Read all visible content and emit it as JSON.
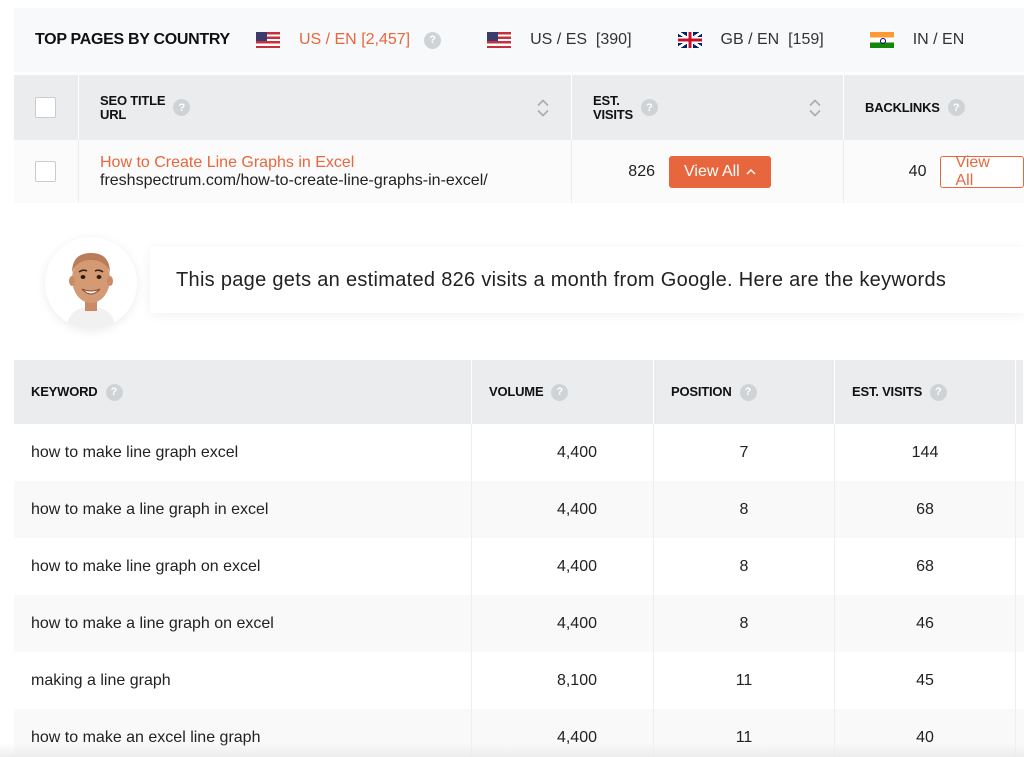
{
  "country_bar": {
    "title": "TOP PAGES BY COUNTRY",
    "tabs": [
      {
        "label": "US / EN",
        "count": "[2,457]",
        "flag": "us-flag-icon",
        "active": true
      },
      {
        "label": "US / ES",
        "count": "[390]",
        "flag": "us-flag-icon",
        "active": false
      },
      {
        "label": "GB / EN",
        "count": "[159]",
        "flag": "gb-flag-icon",
        "active": false
      },
      {
        "label": "IN / EN",
        "count": "",
        "flag": "in-flag-icon",
        "active": false
      }
    ]
  },
  "pages_table": {
    "headers": {
      "title_line1": "SEO TITLE",
      "title_line2": "URL",
      "visits_line1": "EST.",
      "visits_line2": "VISITS",
      "backlinks": "BACKLINKS"
    },
    "row": {
      "title": "How to Create Line Graphs in Excel",
      "url": "freshspectrum.com/how-to-create-line-graphs-in-excel/",
      "est_visits": "826",
      "visits_button": "View All",
      "backlinks": "40",
      "backlinks_button": "View All"
    }
  },
  "message": {
    "text": "This page gets an estimated 826 visits a month from Google. Here are the keywords"
  },
  "keywords_table": {
    "headers": {
      "keyword": "KEYWORD",
      "volume": "VOLUME",
      "position": "POSITION",
      "est_visits": "EST. VISITS"
    },
    "rows": [
      {
        "keyword": "how to make line graph excel",
        "volume": "4,400",
        "position": "7",
        "est_visits": "144"
      },
      {
        "keyword": "how to make a line graph in excel",
        "volume": "4,400",
        "position": "8",
        "est_visits": "68"
      },
      {
        "keyword": "how to make line graph on excel",
        "volume": "4,400",
        "position": "8",
        "est_visits": "68"
      },
      {
        "keyword": "how to make a line graph on excel",
        "volume": "4,400",
        "position": "8",
        "est_visits": "46"
      },
      {
        "keyword": "making a line graph",
        "volume": "8,100",
        "position": "11",
        "est_visits": "45"
      },
      {
        "keyword": "how to make an excel line graph",
        "volume": "4,400",
        "position": "11",
        "est_visits": "40"
      }
    ]
  },
  "colors": {
    "accent": "#e8663d",
    "header_bg": "#ebeced",
    "help_icon": "#d0d3d6"
  }
}
